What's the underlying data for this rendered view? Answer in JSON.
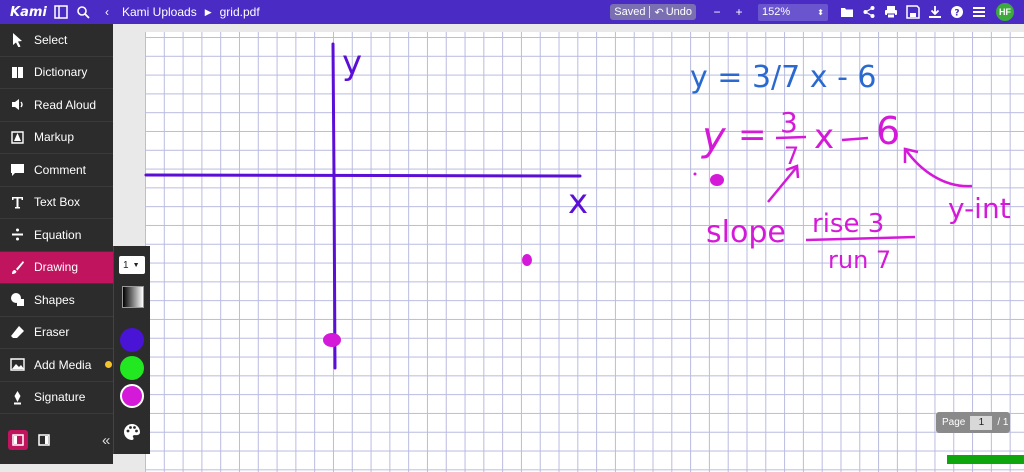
{
  "app": {
    "logo": "Kami"
  },
  "breadcrumb": {
    "folder": "Kami Uploads",
    "file": "grid.pdf"
  },
  "status": {
    "saved": "Saved",
    "undo": "Undo"
  },
  "zoom": {
    "minus": "−",
    "plus": "+",
    "value": "152%"
  },
  "user": {
    "initials": "HF"
  },
  "sidebar": {
    "items": [
      {
        "label": "Select",
        "icon": "cursor-icon"
      },
      {
        "label": "Dictionary",
        "icon": "book-icon"
      },
      {
        "label": "Read Aloud",
        "icon": "speaker-icon"
      },
      {
        "label": "Markup",
        "icon": "markup-icon"
      },
      {
        "label": "Comment",
        "icon": "comment-icon"
      },
      {
        "label": "Text Box",
        "icon": "text-icon"
      },
      {
        "label": "Equation",
        "icon": "divide-icon"
      },
      {
        "label": "Drawing",
        "icon": "brush-icon"
      },
      {
        "label": "Shapes",
        "icon": "shapes-icon"
      },
      {
        "label": "Eraser",
        "icon": "eraser-icon"
      },
      {
        "label": "Add Media",
        "icon": "media-icon"
      },
      {
        "label": "Signature",
        "icon": "pen-icon"
      }
    ],
    "active": "Drawing",
    "collapse": "«"
  },
  "drawing_tools": {
    "size": "1",
    "colors": [
      "#4a14d6",
      "#21e821",
      "#d41ad8"
    ]
  },
  "document": {
    "equation_typed": "y = 3/7 x - 6",
    "handwriting": {
      "y_axis": "y",
      "x_axis": "x",
      "equation": "y = 3/7 x − 6",
      "slope": "slope",
      "rise": "rise 3",
      "run": "run 7",
      "yint": "y-int"
    }
  },
  "pagination": {
    "label": "Page",
    "current": "1",
    "total": "/ 1"
  },
  "colors": {
    "brand": "#4a2bc4",
    "active": "#c0145f",
    "ink_blue": "#5b0fd6",
    "ink_magenta": "#d41ad8"
  }
}
